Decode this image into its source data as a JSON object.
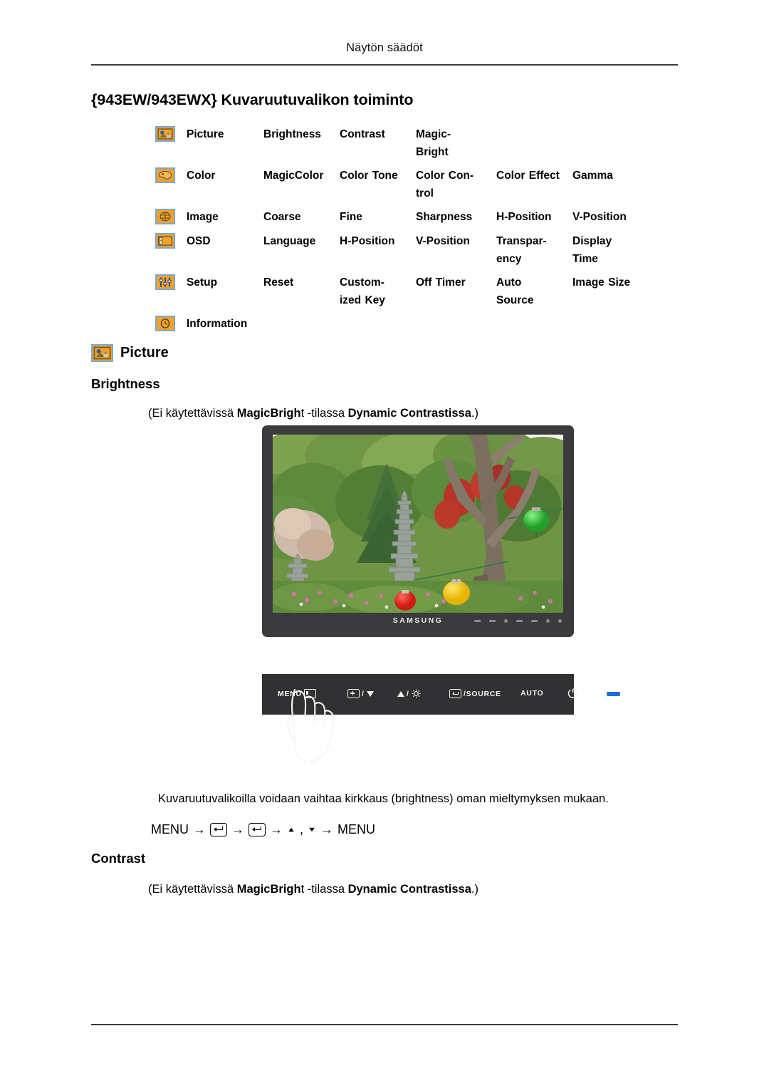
{
  "page": {
    "running_head": "Näytön säädöt",
    "title": "{943EW/943EWX} Kuvaruutuvalikon toiminto"
  },
  "menu_map": {
    "rows": [
      {
        "icon": "picture-icon",
        "name": "Picture",
        "items": [
          "Brightness",
          "Contrast",
          "Magic- Bright",
          "",
          ""
        ]
      },
      {
        "icon": "color-icon",
        "name": "Color",
        "items": [
          "MagicColor",
          "Color Tone",
          "Color  Con- trol",
          "Color Effect",
          "Gamma"
        ]
      },
      {
        "icon": "image-icon",
        "name": "Image",
        "items": [
          "Coarse",
          "Fine",
          "Sharpness",
          "H-Position",
          "V-Position"
        ]
      },
      {
        "icon": "osd-icon",
        "name": "OSD",
        "items": [
          "Language",
          "H-Position",
          "V-Position",
          "Transpar- ency",
          "Display Time"
        ]
      },
      {
        "icon": "setup-icon",
        "name": "Setup",
        "items": [
          "Reset",
          "Custom- ized Key",
          "Off Timer",
          "Auto Source",
          "Image Size"
        ]
      },
      {
        "icon": "information-icon",
        "name": "Information",
        "items": [
          "",
          "",
          "",
          "",
          ""
        ]
      }
    ],
    "row_items": {
      "r0": [
        "Brightness",
        "Contrast",
        "Magic-",
        "Bright",
        "",
        ""
      ],
      "r1": [
        "MagicColor",
        "Color Tone",
        "Color  Con-",
        "trol",
        "Color Effect",
        "Gamma"
      ],
      "r2": [
        "Coarse",
        "Fine",
        "Sharpness",
        "H-Position",
        "V-Position"
      ],
      "r3": [
        "Language",
        "H-Position",
        "V-Position",
        "Transpar-",
        "ency",
        "Display",
        "Time"
      ],
      "r4": [
        "Reset",
        "Custom-",
        "ized Key",
        "Off Timer",
        "Auto",
        "Source",
        "Image Size"
      ]
    }
  },
  "picture_section": {
    "heading": "Picture",
    "icon": "picture-icon",
    "brightness": {
      "heading": "Brightness",
      "note_prefix": "(Ei käytettävissä ",
      "note_bold1": "MagicBrigh",
      "note_mid": "t -tilassa ",
      "note_bold2": "Dynamic Contrastissa",
      "note_suffix": ".)",
      "body": "Kuvaruutuvalikoilla voidaan vaihtaa kirkkaus (brightness) oman mieltymyksen mukaan.",
      "keypath": {
        "start": "MENU",
        "end": "MENU",
        "arrow": "→",
        "comma": ","
      }
    },
    "contrast": {
      "heading": "Contrast",
      "note_prefix": "(Ei käytettävissä ",
      "note_bold1": "MagicBrigh",
      "note_mid": "t -tilassa ",
      "note_bold2": "Dynamic Contrastissa",
      "note_suffix": ".)"
    }
  },
  "monitor": {
    "brand": "SAMSUNG",
    "screen_description": "Korean garden photo with stone pagodas, green trees, pink azaleas and red, yellow and green paper lanterns",
    "controls": [
      {
        "label": "MENU",
        "glyph": "osd-box-icon"
      },
      {
        "label": "/",
        "glyph": "plus-box-and-down-triangle-icon"
      },
      {
        "label": "/",
        "glyph": "up-triangle-and-brightness-icon"
      },
      {
        "label": "SOURCE",
        "glyph": "enter-box-icon"
      },
      {
        "label": "AUTO",
        "glyph": ""
      },
      {
        "label": "",
        "glyph": "power-icon"
      },
      {
        "label": "",
        "glyph": "power-led-indicator"
      }
    ]
  },
  "colors": {
    "icon_fill": "#f0a22e",
    "icon_border": "#7aa7d4",
    "bezel": "#3b3b3d",
    "control_strip": "#313133",
    "led": "#1f6ed4",
    "rule": "#3a3a3c"
  }
}
